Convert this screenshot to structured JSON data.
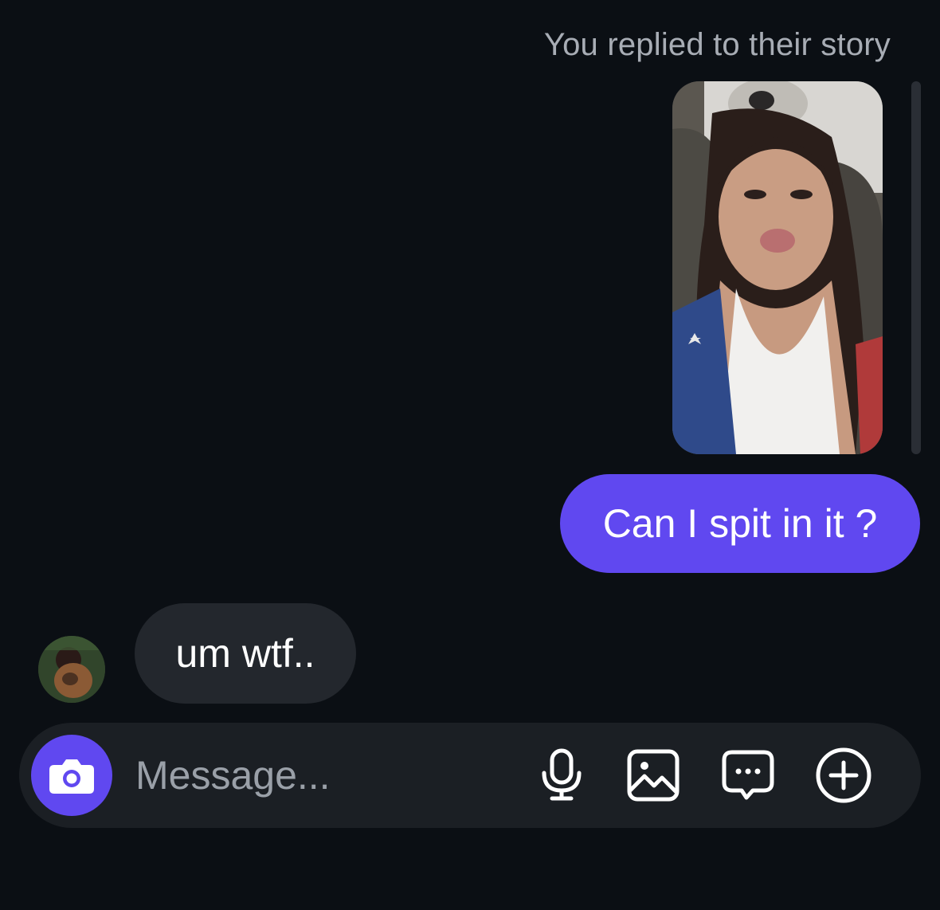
{
  "conversation": {
    "story_reply_label": "You replied to their story",
    "messages": [
      {
        "sender": "me",
        "text": "Can I spit in it ?"
      },
      {
        "sender": "them",
        "text": "um wtf.."
      }
    ]
  },
  "composer": {
    "placeholder": "Message...",
    "icons": [
      "camera-icon",
      "microphone-icon",
      "gallery-icon",
      "sticker-chat-icon",
      "plus-circle-icon"
    ]
  },
  "colors": {
    "background": "#0b0f14",
    "outgoing_bubble": "#6048f0",
    "incoming_bubble": "#23272d",
    "composer_bar": "#1b1f24",
    "muted_text": "#a8adb5"
  }
}
